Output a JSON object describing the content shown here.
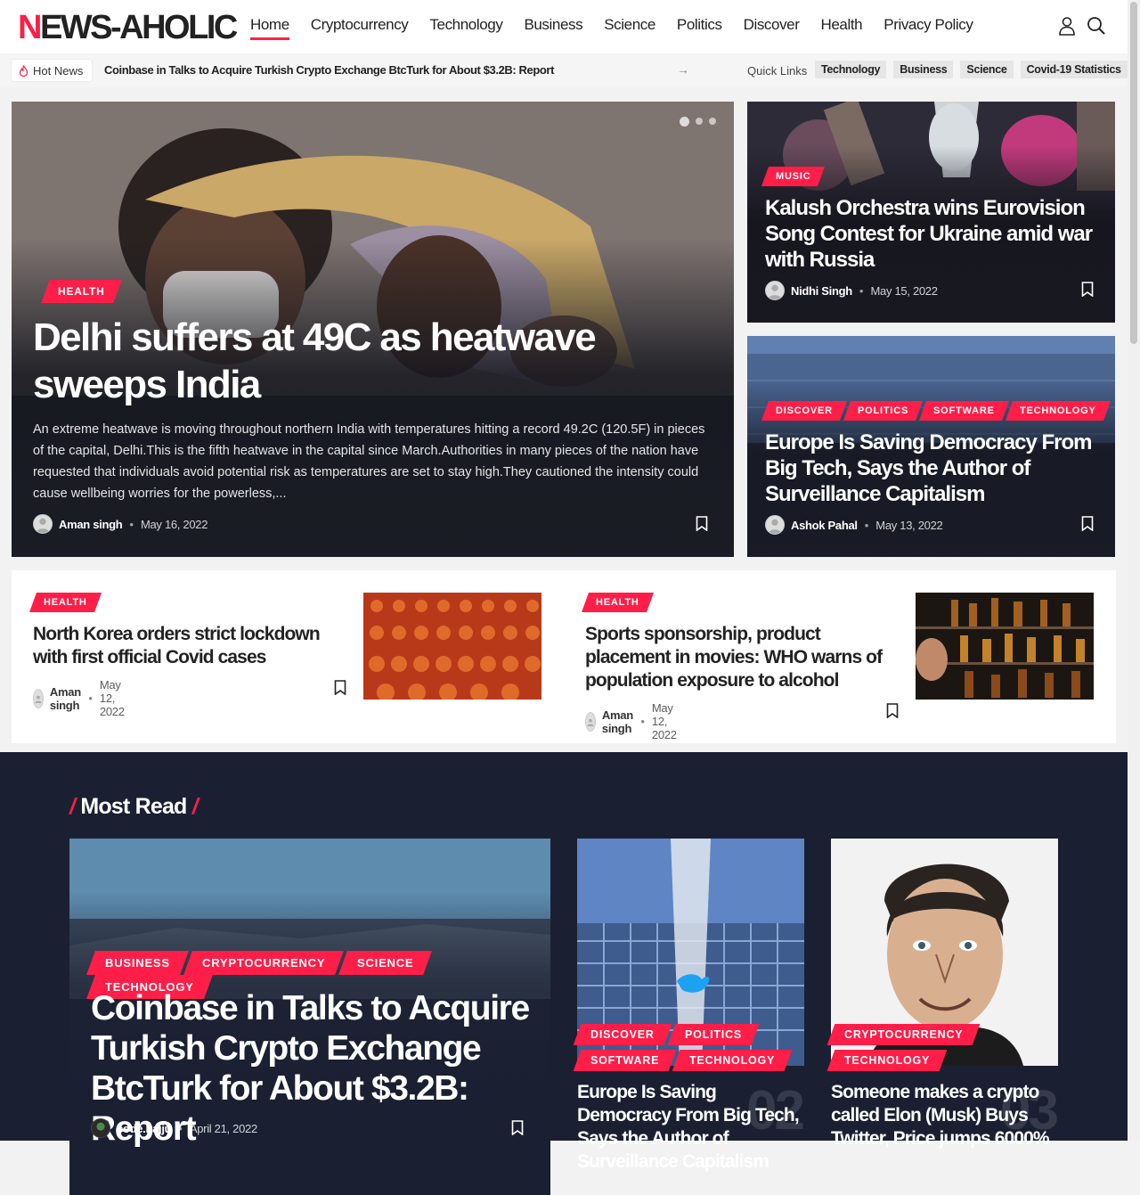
{
  "header": {
    "logo_first": "N",
    "logo_rest": "EWS-AHOLIC",
    "nav": [
      "Home",
      "Cryptocurrency",
      "Technology",
      "Business",
      "Science",
      "Politics",
      "Discover",
      "Health",
      "Privacy Policy"
    ],
    "active_nav": "Home",
    "icons": [
      "user-icon",
      "search-icon"
    ]
  },
  "subbar": {
    "hot_label": "Hot News",
    "ticker": "Coinbase in Talks to Acquire Turkish Crypto Exchange BtcTurk for About $3.2B: Report",
    "quick_label": "Quick Links",
    "quick_links": [
      "Technology",
      "Business",
      "Science",
      "Covid-19 Statistics"
    ]
  },
  "hero": {
    "category": "HEALTH",
    "title": "Delhi suffers at 49C as heatwave sweeps India",
    "excerpt": "An extreme heatwave is moving throughout northern India with temperatures hitting a record 49.2C (120.5F) in pieces of the capital, Delhi.This is the fifth heatwave in the capital since March.Authorities in many pieces of the nation have requested that individuals avoid potential risk as temperatures are set to stay high.They cautioned the intensity could cause wellbeing worries for the powerless,...",
    "author": "Aman singh",
    "date": "May 16, 2022"
  },
  "side_cards": [
    {
      "categories": [
        "MUSIC"
      ],
      "title": "Kalush Orchestra wins Eurovision Song Contest for Ukraine amid war with Russia",
      "author": "Nidhi Singh",
      "date": "May 15, 2022"
    },
    {
      "categories": [
        "DISCOVER",
        "POLITICS",
        "SOFTWARE",
        "TECHNOLOGY"
      ],
      "title": "Europe Is Saving Democracy From Big Tech, Says the Author of Surveillance Capitalism",
      "author": "Ashok Pahal",
      "date": "May 13, 2022"
    }
  ],
  "row_items": [
    {
      "category": "HEALTH",
      "title": "North Korea orders strict lockdown with first official Covid cases",
      "author": "Aman singh",
      "date": "May 12, 2022"
    },
    {
      "category": "HEALTH",
      "title": "Sports sponsorship, product placement in movies: WHO warns of population exposure to alcohol",
      "author": "Aman singh",
      "date": "May 12, 2022"
    }
  ],
  "most_read": {
    "heading": "Most Read",
    "big": {
      "categories": [
        "BUSINESS",
        "CRYPTOCURRENCY",
        "SCIENCE",
        "TECHNOLOGY"
      ],
      "title": "Coinbase in Talks to Acquire Turkish Crypto Exchange BtcTurk for About $3.2B: Report",
      "author": "code.bajju",
      "date": "April 21, 2022"
    },
    "small": [
      {
        "number": "02",
        "categories": [
          "DISCOVER",
          "POLITICS",
          "SOFTWARE",
          "TECHNOLOGY"
        ],
        "title": "Europe Is Saving Democracy From Big Tech, Says the Author of Surveillance Capitalism"
      },
      {
        "number": "03",
        "categories": [
          "CRYPTOCURRENCY",
          "TECHNOLOGY"
        ],
        "title": "Someone makes a crypto called Elon (Musk) Buys Twitter, Price jumps 6000%"
      }
    ]
  }
}
